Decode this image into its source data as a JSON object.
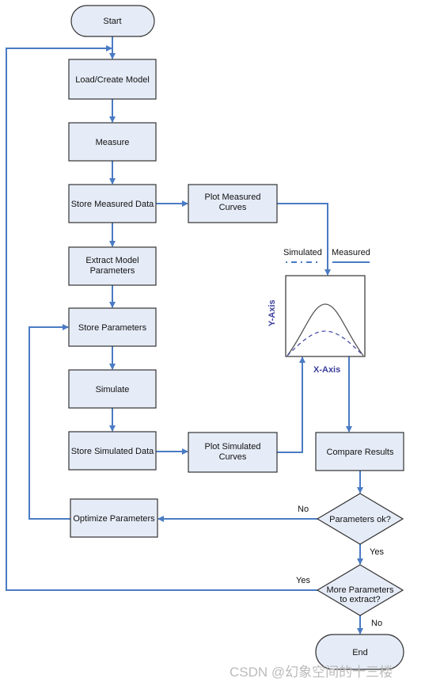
{
  "nodes": {
    "start": "Start",
    "load": "Load/Create Model",
    "measure": "Measure",
    "store_measured": "Store Measured Data",
    "extract": [
      "Extract Model",
      "Parameters"
    ],
    "store_params": "Store Parameters",
    "simulate": "Simulate",
    "store_simulated": "Store Simulated Data",
    "optimize": "Optimize Parameters",
    "plot_measured": [
      "Plot Measured",
      "Curves"
    ],
    "plot_simulated": [
      "Plot Simulated",
      "Curves"
    ],
    "compare": "Compare Results",
    "params_ok": "Parameters ok?",
    "more_params": [
      "More Parameters",
      "to extract?"
    ],
    "end": "End"
  },
  "edge_labels": {
    "no1": "No",
    "yes1": "Yes",
    "yes2": "Yes",
    "no2": "No"
  },
  "chart": {
    "legend_simulated": "Simulated",
    "legend_measured": "Measured",
    "y_axis": "Y-Axis",
    "x_axis": "X-Axis"
  },
  "watermark": "CSDN @幻象空间的十三楼",
  "colors": {
    "arrow": "#4a7bc4",
    "box_fill": "#e6ecf7",
    "axis_label": "#3b3f9a"
  }
}
